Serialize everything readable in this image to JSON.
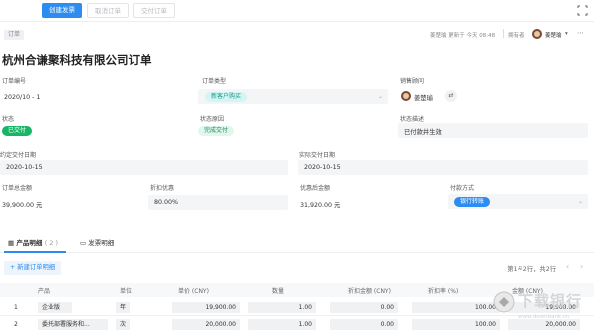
{
  "toolbar": {
    "create_invoice": "创建发票",
    "cancel_order": "取消订单",
    "deliver_order": "交付订单"
  },
  "header": {
    "doc_tag": "订单",
    "updated_by": "姜楚瑜",
    "updated_text": "更新于 今天 08:48",
    "owner_label": "拥有者",
    "owner_name": "姜楚瑜",
    "title": "杭州合谦聚科技有限公司订单"
  },
  "fields": {
    "order_no_label": "订单编号",
    "order_no": "2020/10 - 1",
    "order_type_label": "订单类型",
    "order_type": "新客户购买",
    "sales_label": "销售顾问",
    "sales_name": "姜楚瑜",
    "status_label": "状态",
    "status": "已交付",
    "status_reason_label": "状态原因",
    "status_reason": "完成交付",
    "status_desc_label": "状态描述",
    "status_desc": "已付款并生效",
    "planned_date_label": "约定交付日期",
    "planned_date": "2020-10-15",
    "actual_date_label": "实际交付日期",
    "actual_date": "2020-10-15",
    "total_label": "订单总金额",
    "total": "39,900.00 元",
    "discount_label": "折扣优惠",
    "discount": "80.00%",
    "after_label": "优惠后金额",
    "after": "31,920.00 元",
    "pay_label": "付款方式",
    "pay": "银行转账"
  },
  "tabs": {
    "products": "产品明细",
    "products_count": "( 2 )",
    "invoice": "发票明细"
  },
  "list": {
    "new_button": "+ 新建订单明细",
    "pager": "第1~2行，共2行",
    "columns": [
      "产品",
      "单位",
      "单价 (CNY)",
      "数量",
      "折扣金额 (CNY)",
      "折扣率 (%)",
      "金额 (CNY)"
    ],
    "rows": [
      {
        "no": "1",
        "product": "企业版",
        "unit": "年",
        "price": "19,900.00",
        "qty": "1.00",
        "discount": "0.00",
        "rate": "100.00",
        "amount": "19,900.00"
      },
      {
        "no": "2",
        "product": "委托部署服务和...",
        "unit": "次",
        "price": "20,000.00",
        "qty": "1.00",
        "discount": "0.00",
        "rate": "100.00",
        "amount": "20,000.00"
      }
    ]
  },
  "watermark": {
    "text": "下载银行",
    "url": "www.downbank.cn"
  }
}
